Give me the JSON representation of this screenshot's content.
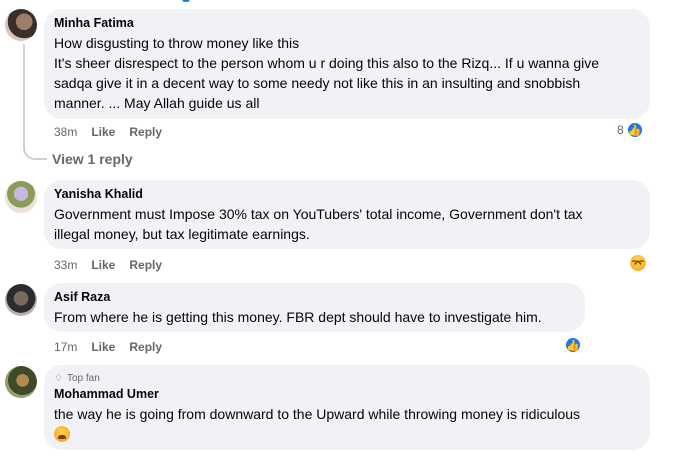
{
  "comments": [
    {
      "author": "Minha Fatima",
      "lines": [
        "How disgusting to throw money like this",
        "It's sheer disrespect to the person whom u r doing this also to the Rizq... If u wanna give",
        "sadqa give it in a decent way to some needy not like this in an insulting and snobbish",
        "manner. ... May Allah guide us all"
      ],
      "time": "38m",
      "like_label": "Like",
      "reply_label": "Reply",
      "reaction_count": "8",
      "reaction_icon": "like-icon"
    },
    {
      "author": "Yanisha Khalid",
      "lines": [
        "Government must Impose 30% tax on YouTubers' total income, Government don't tax",
        "illegal money, but tax legitimate earnings."
      ],
      "time": "33m",
      "like_label": "Like",
      "reply_label": "Reply",
      "reaction_icon": "haha-icon"
    },
    {
      "author": "Asif Raza",
      "lines": [
        "From where he is getting this money. FBR dept should have to investigate him."
      ],
      "time": "17m",
      "like_label": "Like",
      "reply_label": "Reply",
      "reaction_icon": "like-icon"
    },
    {
      "badge": "Top fan",
      "author": "Mohammad Umer",
      "lines": [
        "the way he is going from downward to the Upward while throwing money is ridiculous"
      ],
      "emoji": "crying-laughing-emoji"
    }
  ],
  "view_replies_label": "View 1 reply",
  "colors": {
    "bubble": "#f0f2f5",
    "meta_text": "#65676b",
    "accent": "#1877f2"
  }
}
